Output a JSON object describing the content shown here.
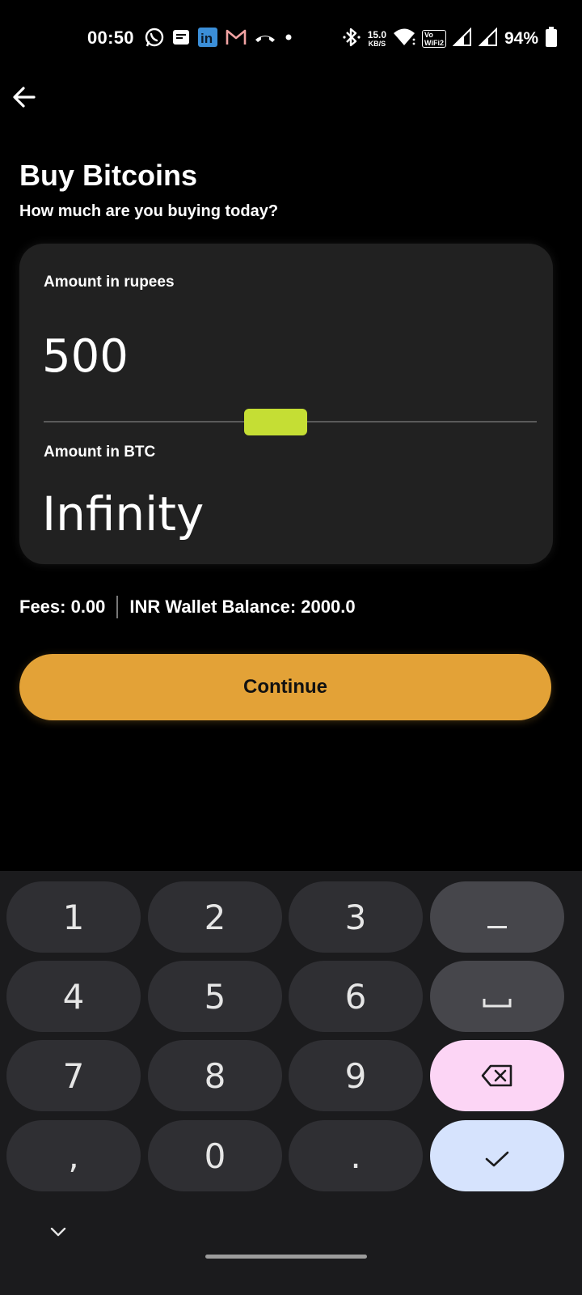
{
  "status_bar": {
    "time": "00:50",
    "network_speed_value": "15.0",
    "network_speed_unit": "KB/S",
    "volte_label_top": "Vo",
    "volte_label_bottom": "WiFi2",
    "battery_percent": "94%",
    "notification_icons": [
      "whatsapp-icon",
      "messages-icon",
      "linkedin-icon",
      "gmail-icon",
      "missed-call-icon",
      "dot-icon"
    ],
    "system_icons": [
      "bluetooth-icon",
      "wifi-icon",
      "signal-icon",
      "signal-icon",
      "battery-icon"
    ]
  },
  "header": {
    "title": "Buy Bitcoins",
    "subtitle": "How much are you buying today?"
  },
  "card": {
    "rupees_label": "Amount in rupees",
    "rupees_value": "500",
    "btc_label": "Amount in BTC",
    "btc_value": "Infinity",
    "slider_position": 0.47
  },
  "info": {
    "fees": "Fees: 0.00",
    "wallet_balance": "INR Wallet Balance: 2000.0"
  },
  "continue_label": "Continue",
  "keyboard": {
    "keys": [
      "1",
      "2",
      "3",
      "−",
      "4",
      "5",
      "6",
      "␣",
      "7",
      "8",
      "9",
      "⌫",
      ",",
      "0",
      ".",
      "✓"
    ]
  },
  "colors": {
    "accent": "#e3a237",
    "slider_thumb": "#c5de34",
    "card_bg": "#212121",
    "delete_key": "#fcd5f5",
    "done_key": "#d6e3fd"
  }
}
